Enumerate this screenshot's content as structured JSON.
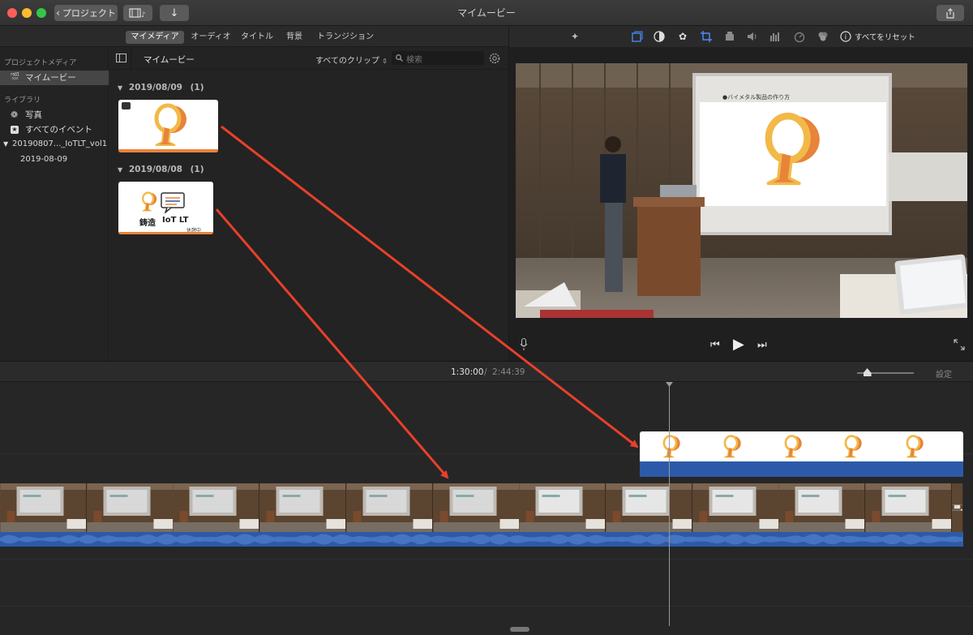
{
  "window": {
    "title": "マイムービー",
    "back_label": "プロジェクト"
  },
  "media_tabs": [
    "マイメディア",
    "オーディオ",
    "タイトル",
    "背景",
    "トランジション"
  ],
  "sidebar": {
    "project_media_heading": "プロジェクトメディア",
    "project_item": "マイムービー",
    "library_heading": "ライブラリ",
    "library_items": [
      {
        "label": "写真",
        "icon": "photos-icon"
      },
      {
        "label": "すべてのイベント",
        "icon": "star-icon"
      }
    ],
    "event_label": "20190807..._IoTLT_vol1",
    "event_date": "2019-08-09"
  },
  "browser": {
    "title": "マイムービー",
    "filter_label": "すべてのクリップ",
    "search_placeholder": "検索",
    "groups": [
      {
        "date": "2019/08/09",
        "count": "(1)"
      },
      {
        "date": "2019/08/08",
        "count": "(1)"
      }
    ],
    "thumb2_text_left": "鋳造",
    "thumb2_text_right": "IoT LT",
    "thumb2_small": "休憩中"
  },
  "viewer": {
    "reset_label": "すべてをリセット",
    "slide_heading": "●バイメタル製品の作り方"
  },
  "timeline": {
    "current_time": "1:30:00",
    "separator": "/",
    "total_time": "2:44:39",
    "settings_label": "設定",
    "zoom_level": 0.18
  },
  "colors": {
    "accent_blue": "#2c5aa8",
    "arrow_red": "#e8402a",
    "logo_orange": "#e8833a",
    "logo_yellow": "#f2b948"
  }
}
